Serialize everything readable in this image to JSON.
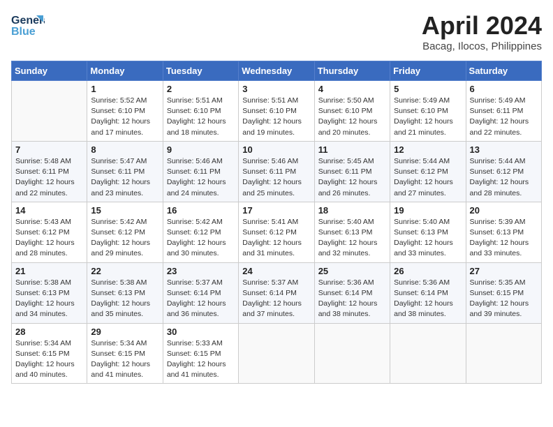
{
  "logo": {
    "line1": "General",
    "line2": "Blue"
  },
  "title": "April 2024",
  "subtitle": "Bacag, Ilocos, Philippines",
  "days_header": [
    "Sunday",
    "Monday",
    "Tuesday",
    "Wednesday",
    "Thursday",
    "Friday",
    "Saturday"
  ],
  "weeks": [
    [
      {
        "day": "",
        "info": ""
      },
      {
        "day": "1",
        "info": "Sunrise: 5:52 AM\nSunset: 6:10 PM\nDaylight: 12 hours\nand 17 minutes."
      },
      {
        "day": "2",
        "info": "Sunrise: 5:51 AM\nSunset: 6:10 PM\nDaylight: 12 hours\nand 18 minutes."
      },
      {
        "day": "3",
        "info": "Sunrise: 5:51 AM\nSunset: 6:10 PM\nDaylight: 12 hours\nand 19 minutes."
      },
      {
        "day": "4",
        "info": "Sunrise: 5:50 AM\nSunset: 6:10 PM\nDaylight: 12 hours\nand 20 minutes."
      },
      {
        "day": "5",
        "info": "Sunrise: 5:49 AM\nSunset: 6:10 PM\nDaylight: 12 hours\nand 21 minutes."
      },
      {
        "day": "6",
        "info": "Sunrise: 5:49 AM\nSunset: 6:11 PM\nDaylight: 12 hours\nand 22 minutes."
      }
    ],
    [
      {
        "day": "7",
        "info": "Sunrise: 5:48 AM\nSunset: 6:11 PM\nDaylight: 12 hours\nand 22 minutes."
      },
      {
        "day": "8",
        "info": "Sunrise: 5:47 AM\nSunset: 6:11 PM\nDaylight: 12 hours\nand 23 minutes."
      },
      {
        "day": "9",
        "info": "Sunrise: 5:46 AM\nSunset: 6:11 PM\nDaylight: 12 hours\nand 24 minutes."
      },
      {
        "day": "10",
        "info": "Sunrise: 5:46 AM\nSunset: 6:11 PM\nDaylight: 12 hours\nand 25 minutes."
      },
      {
        "day": "11",
        "info": "Sunrise: 5:45 AM\nSunset: 6:11 PM\nDaylight: 12 hours\nand 26 minutes."
      },
      {
        "day": "12",
        "info": "Sunrise: 5:44 AM\nSunset: 6:12 PM\nDaylight: 12 hours\nand 27 minutes."
      },
      {
        "day": "13",
        "info": "Sunrise: 5:44 AM\nSunset: 6:12 PM\nDaylight: 12 hours\nand 28 minutes."
      }
    ],
    [
      {
        "day": "14",
        "info": "Sunrise: 5:43 AM\nSunset: 6:12 PM\nDaylight: 12 hours\nand 28 minutes."
      },
      {
        "day": "15",
        "info": "Sunrise: 5:42 AM\nSunset: 6:12 PM\nDaylight: 12 hours\nand 29 minutes."
      },
      {
        "day": "16",
        "info": "Sunrise: 5:42 AM\nSunset: 6:12 PM\nDaylight: 12 hours\nand 30 minutes."
      },
      {
        "day": "17",
        "info": "Sunrise: 5:41 AM\nSunset: 6:12 PM\nDaylight: 12 hours\nand 31 minutes."
      },
      {
        "day": "18",
        "info": "Sunrise: 5:40 AM\nSunset: 6:13 PM\nDaylight: 12 hours\nand 32 minutes."
      },
      {
        "day": "19",
        "info": "Sunrise: 5:40 AM\nSunset: 6:13 PM\nDaylight: 12 hours\nand 33 minutes."
      },
      {
        "day": "20",
        "info": "Sunrise: 5:39 AM\nSunset: 6:13 PM\nDaylight: 12 hours\nand 33 minutes."
      }
    ],
    [
      {
        "day": "21",
        "info": "Sunrise: 5:38 AM\nSunset: 6:13 PM\nDaylight: 12 hours\nand 34 minutes."
      },
      {
        "day": "22",
        "info": "Sunrise: 5:38 AM\nSunset: 6:13 PM\nDaylight: 12 hours\nand 35 minutes."
      },
      {
        "day": "23",
        "info": "Sunrise: 5:37 AM\nSunset: 6:14 PM\nDaylight: 12 hours\nand 36 minutes."
      },
      {
        "day": "24",
        "info": "Sunrise: 5:37 AM\nSunset: 6:14 PM\nDaylight: 12 hours\nand 37 minutes."
      },
      {
        "day": "25",
        "info": "Sunrise: 5:36 AM\nSunset: 6:14 PM\nDaylight: 12 hours\nand 38 minutes."
      },
      {
        "day": "26",
        "info": "Sunrise: 5:36 AM\nSunset: 6:14 PM\nDaylight: 12 hours\nand 38 minutes."
      },
      {
        "day": "27",
        "info": "Sunrise: 5:35 AM\nSunset: 6:15 PM\nDaylight: 12 hours\nand 39 minutes."
      }
    ],
    [
      {
        "day": "28",
        "info": "Sunrise: 5:34 AM\nSunset: 6:15 PM\nDaylight: 12 hours\nand 40 minutes."
      },
      {
        "day": "29",
        "info": "Sunrise: 5:34 AM\nSunset: 6:15 PM\nDaylight: 12 hours\nand 41 minutes."
      },
      {
        "day": "30",
        "info": "Sunrise: 5:33 AM\nSunset: 6:15 PM\nDaylight: 12 hours\nand 41 minutes."
      },
      {
        "day": "",
        "info": ""
      },
      {
        "day": "",
        "info": ""
      },
      {
        "day": "",
        "info": ""
      },
      {
        "day": "",
        "info": ""
      }
    ]
  ]
}
